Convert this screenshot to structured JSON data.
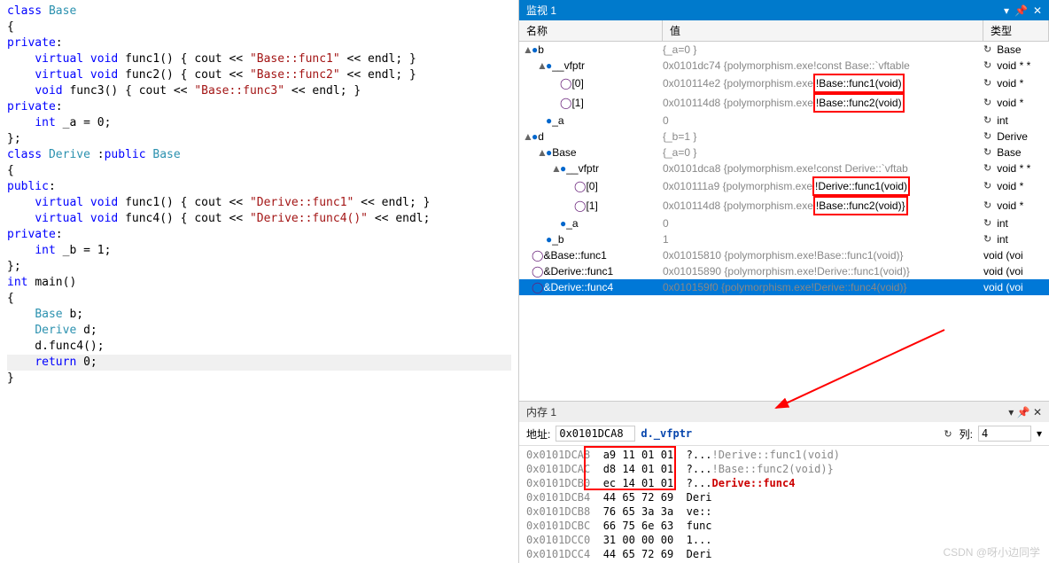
{
  "code": {
    "lines": [
      [
        {
          "t": "class ",
          "c": "kw"
        },
        {
          "t": "Base",
          "c": "type"
        }
      ],
      [
        {
          "t": "{"
        }
      ],
      [
        {
          "t": "private",
          "c": "kw"
        },
        {
          "t": ":"
        }
      ],
      [
        {
          "t": "    "
        },
        {
          "t": "virtual void ",
          "c": "kw"
        },
        {
          "t": "func1() { cout << "
        },
        {
          "t": "\"Base::func1\"",
          "c": "str"
        },
        {
          "t": " << endl; }"
        }
      ],
      [
        {
          "t": "    "
        },
        {
          "t": "virtual void ",
          "c": "kw"
        },
        {
          "t": "func2() { cout << "
        },
        {
          "t": "\"Base::func2\"",
          "c": "str"
        },
        {
          "t": " << endl; }"
        }
      ],
      [
        {
          "t": "    "
        },
        {
          "t": "void ",
          "c": "kw"
        },
        {
          "t": "func3() { cout << "
        },
        {
          "t": "\"Base::func3\"",
          "c": "str"
        },
        {
          "t": " << endl; }"
        }
      ],
      [
        {
          "t": ""
        }
      ],
      [
        {
          "t": "private",
          "c": "kw"
        },
        {
          "t": ":"
        }
      ],
      [
        {
          "t": "    "
        },
        {
          "t": "int ",
          "c": "kw"
        },
        {
          "t": "_a = 0;"
        }
      ],
      [
        {
          "t": "};"
        }
      ],
      [
        {
          "t": ""
        }
      ],
      [
        {
          "t": "class ",
          "c": "kw"
        },
        {
          "t": "Derive ",
          "c": "type"
        },
        {
          "t": ":"
        },
        {
          "t": "public ",
          "c": "kw"
        },
        {
          "t": "Base",
          "c": "type"
        }
      ],
      [
        {
          "t": "{"
        }
      ],
      [
        {
          "t": "public",
          "c": "kw"
        },
        {
          "t": ":"
        }
      ],
      [
        {
          "t": "    "
        },
        {
          "t": "virtual void ",
          "c": "kw"
        },
        {
          "t": "func1() { cout << "
        },
        {
          "t": "\"Derive::func1\"",
          "c": "str"
        },
        {
          "t": " << endl; }"
        }
      ],
      [
        {
          "t": "    "
        },
        {
          "t": "virtual void ",
          "c": "kw"
        },
        {
          "t": "func4() { cout << "
        },
        {
          "t": "\"Derive::func4()\"",
          "c": "str"
        },
        {
          "t": " << endl;"
        }
      ],
      [
        {
          "t": "private",
          "c": "kw"
        },
        {
          "t": ":"
        }
      ],
      [
        {
          "t": "    "
        },
        {
          "t": "int ",
          "c": "kw"
        },
        {
          "t": "_b = 1;"
        }
      ],
      [
        {
          "t": "};"
        }
      ],
      [
        {
          "t": ""
        }
      ],
      [
        {
          "t": "int ",
          "c": "kw"
        },
        {
          "t": "main()"
        }
      ],
      [
        {
          "t": "{"
        }
      ],
      [
        {
          "t": "    "
        },
        {
          "t": "Base ",
          "c": "type"
        },
        {
          "t": "b;"
        }
      ],
      [
        {
          "t": "    "
        },
        {
          "t": "Derive ",
          "c": "type"
        },
        {
          "t": "d;"
        }
      ],
      [
        {
          "t": ""
        }
      ],
      [
        {
          "t": "    d.func4();"
        }
      ],
      [
        {
          "t": ""
        }
      ],
      [
        {
          "t": "    "
        },
        {
          "t": "return ",
          "c": "kw"
        },
        {
          "t": "0;"
        }
      ],
      [
        {
          "t": "}"
        }
      ]
    ],
    "hl_index": 27
  },
  "watch": {
    "title": "监视 1",
    "cols": {
      "name": "名称",
      "value": "值",
      "type": "类型"
    },
    "rows": [
      {
        "indent": 0,
        "tri": "▲",
        "icon": "●",
        "iconC": "icon-blue",
        "name": "b",
        "val": "{_a=0 }",
        "type": "Base",
        "refresh": true
      },
      {
        "indent": 1,
        "tri": "▲",
        "icon": "●",
        "iconC": "icon-blue",
        "name": "__vfptr",
        "val": "0x0101dc74 {polymorphism.exe!const Base::`vftable",
        "type": "void * *",
        "refresh": true
      },
      {
        "indent": 2,
        "tri": "",
        "icon": "◯",
        "iconC": "icon-purple",
        "name": "[0]",
        "val": "0x010114e2 {polymorphism.exe",
        "valSuffix": "!Base::func1(void)",
        "box": true,
        "type": "void *",
        "refresh": true
      },
      {
        "indent": 2,
        "tri": "",
        "icon": "◯",
        "iconC": "icon-purple",
        "name": "[1]",
        "val": "0x010114d8 {polymorphism.exe",
        "valSuffix": "!Base::func2(void)",
        "box": true,
        "type": "void *",
        "refresh": true
      },
      {
        "indent": 1,
        "tri": "",
        "icon": "●",
        "iconC": "icon-blue",
        "name": "_a",
        "val": "0",
        "type": "int",
        "refresh": true,
        "lock": true
      },
      {
        "indent": 0,
        "tri": "▲",
        "icon": "●",
        "iconC": "icon-blue",
        "name": "d",
        "val": "{_b=1 }",
        "type": "Derive",
        "refresh": true
      },
      {
        "indent": 1,
        "tri": "▲",
        "icon": "●",
        "iconC": "icon-blue",
        "name": "Base",
        "val": "{_a=0 }",
        "type": "Base",
        "refresh": true
      },
      {
        "indent": 2,
        "tri": "▲",
        "icon": "●",
        "iconC": "icon-blue",
        "name": "__vfptr",
        "val": "0x0101dca8 {polymorphism.exe!const Derive::`vftab",
        "type": "void * *",
        "refresh": true
      },
      {
        "indent": 3,
        "tri": "",
        "icon": "◯",
        "iconC": "icon-purple",
        "name": "[0]",
        "val": "0x010111a9 {polymorphism.exe",
        "valSuffix": "!Derive::func1(void)",
        "box": true,
        "type": "void *",
        "refresh": true
      },
      {
        "indent": 3,
        "tri": "",
        "icon": "◯",
        "iconC": "icon-purple",
        "name": "[1]",
        "val": "0x010114d8 {polymorphism.exe",
        "valSuffix": "!Base::func2(void)}",
        "box": true,
        "type": "void *",
        "refresh": true
      },
      {
        "indent": 2,
        "tri": "",
        "icon": "●",
        "iconC": "icon-blue",
        "name": "_a",
        "val": "0",
        "type": "int",
        "refresh": true,
        "lock": true
      },
      {
        "indent": 1,
        "tri": "",
        "icon": "●",
        "iconC": "icon-blue",
        "name": "_b",
        "val": "1",
        "type": "int",
        "refresh": true,
        "lock": true
      },
      {
        "indent": 0,
        "tri": "",
        "icon": "◯",
        "iconC": "icon-purple",
        "name": "&Base::func1",
        "val": "0x01015810 {polymorphism.exe!Base::func1(void)}",
        "type": "void (voi"
      },
      {
        "indent": 0,
        "tri": "",
        "icon": "◯",
        "iconC": "icon-purple",
        "name": "&Derive::func1",
        "val": "0x01015890 {polymorphism.exe!Derive::func1(void)}",
        "type": "void (voi"
      },
      {
        "indent": 0,
        "tri": "",
        "icon": "◯",
        "iconC": "icon-purple",
        "name": "&Derive::func4",
        "val": "0x010159f0 {polymorphism.exe!Derive::func4(void)}",
        "type": "void (voi",
        "selected": true
      }
    ]
  },
  "memory": {
    "title": "内存 1",
    "addr_label": "地址:",
    "addr_value": "0x0101DCA8",
    "comment": "d._vfptr",
    "col_label": "列:",
    "col_value": "4",
    "rows": [
      {
        "addr": "0x0101DCA8",
        "bytes": "a9 11 01 01",
        "ascii": "?...",
        "note": "!Derive::func1(void)"
      },
      {
        "addr": "0x0101DCAC",
        "bytes": "d8 14 01 01",
        "ascii": "?...",
        "note": "!Base::func2(void)}"
      },
      {
        "addr": "0x0101DCB0",
        "bytes": "ec 14 01 01",
        "ascii": "?...",
        "note": "Derive::func4",
        "noteRed": true
      },
      {
        "addr": "0x0101DCB4",
        "bytes": "44 65 72 69",
        "ascii": "Deri"
      },
      {
        "addr": "0x0101DCB8",
        "bytes": "76 65 3a 3a",
        "ascii": "ve::"
      },
      {
        "addr": "0x0101DCBC",
        "bytes": "66 75 6e 63",
        "ascii": "func"
      },
      {
        "addr": "0x0101DCC0",
        "bytes": "31 00 00 00",
        "ascii": "1..."
      },
      {
        "addr": "0x0101DCC4",
        "bytes": "44 65 72 69",
        "ascii": "Deri"
      }
    ]
  },
  "watermark": "CSDN @呀小边同学"
}
